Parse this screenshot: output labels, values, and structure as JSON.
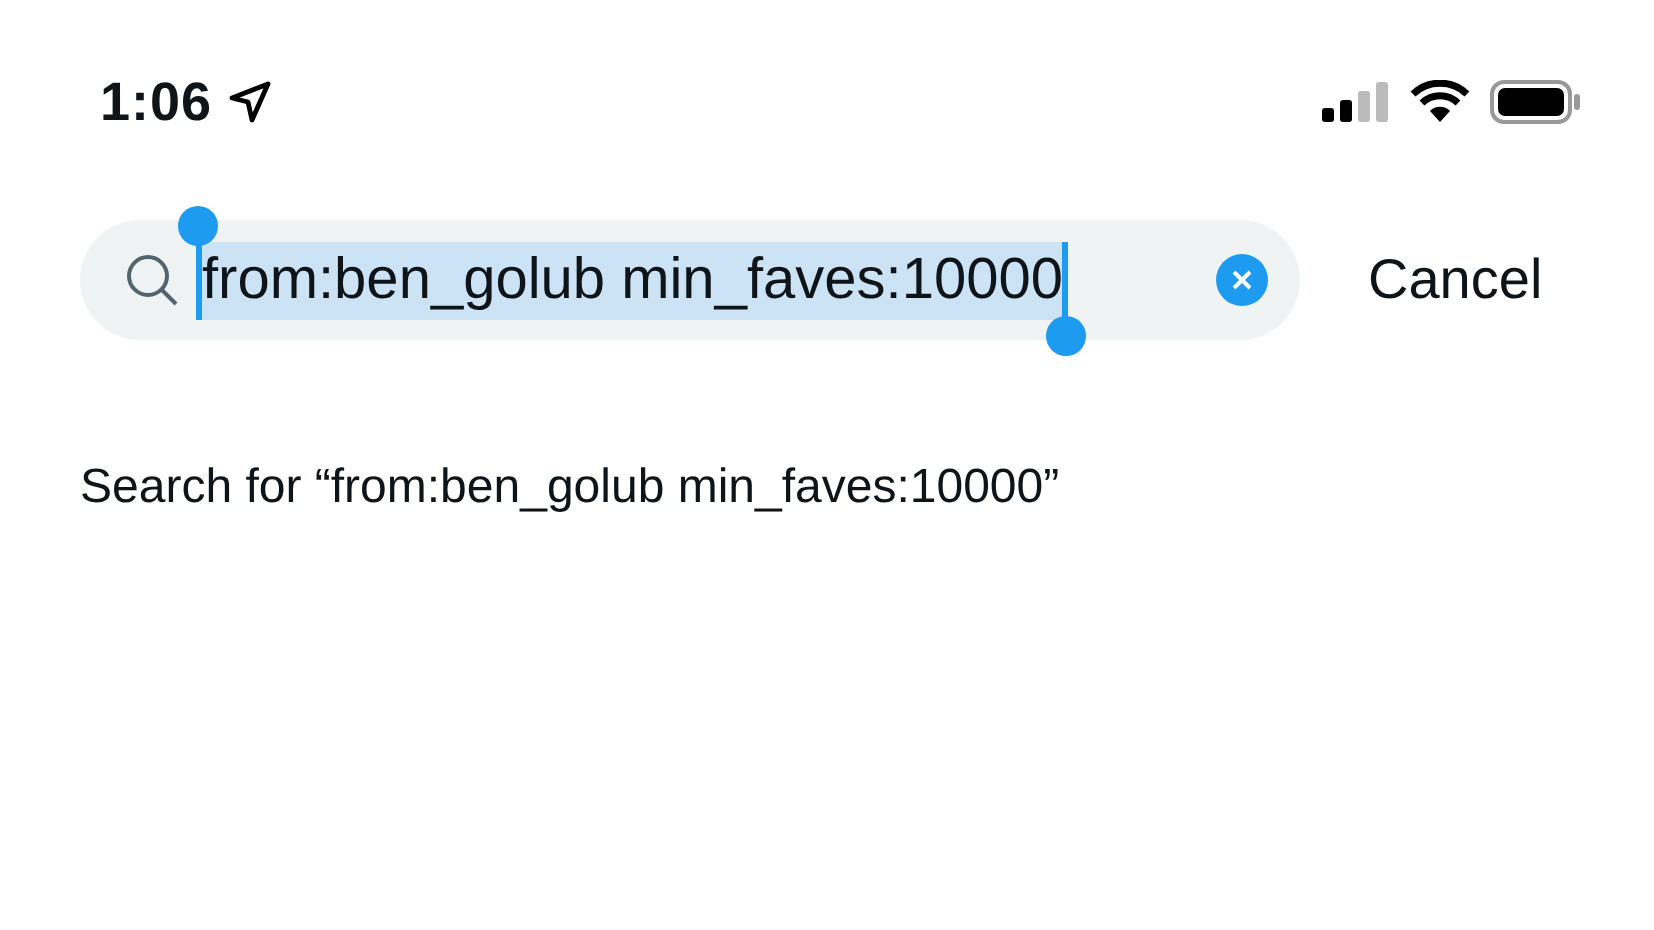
{
  "status_bar": {
    "time": "1:06"
  },
  "search": {
    "value": "from:ben_golub min_faves:10000",
    "selected": true
  },
  "cancel_button": "Cancel",
  "suggestions": [
    {
      "text": "Search for “from:ben_golub min_faves:10000”"
    }
  ]
}
